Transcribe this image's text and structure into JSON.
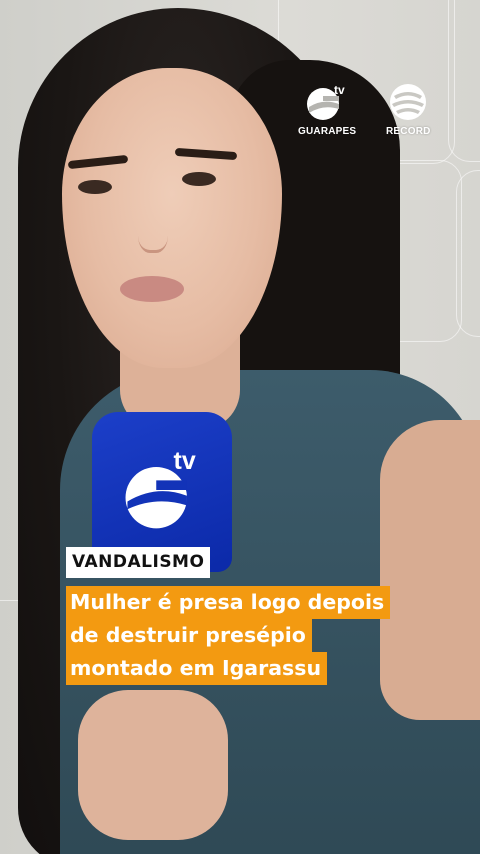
{
  "brand": {
    "station_label": "GUARAPES",
    "station_logo_text": "tv",
    "network_label": "RECORD",
    "mic_logo_text": "tv",
    "colors": {
      "caption_bg": "#f39a11",
      "tag_bg": "#ffffff",
      "mic_blue": "#1233b8"
    }
  },
  "caption": {
    "tag": "VANDALISMO",
    "headline_lines": [
      "Mulher é presa logo depois",
      "de destruir presépio",
      "montado em Igarassu"
    ]
  }
}
